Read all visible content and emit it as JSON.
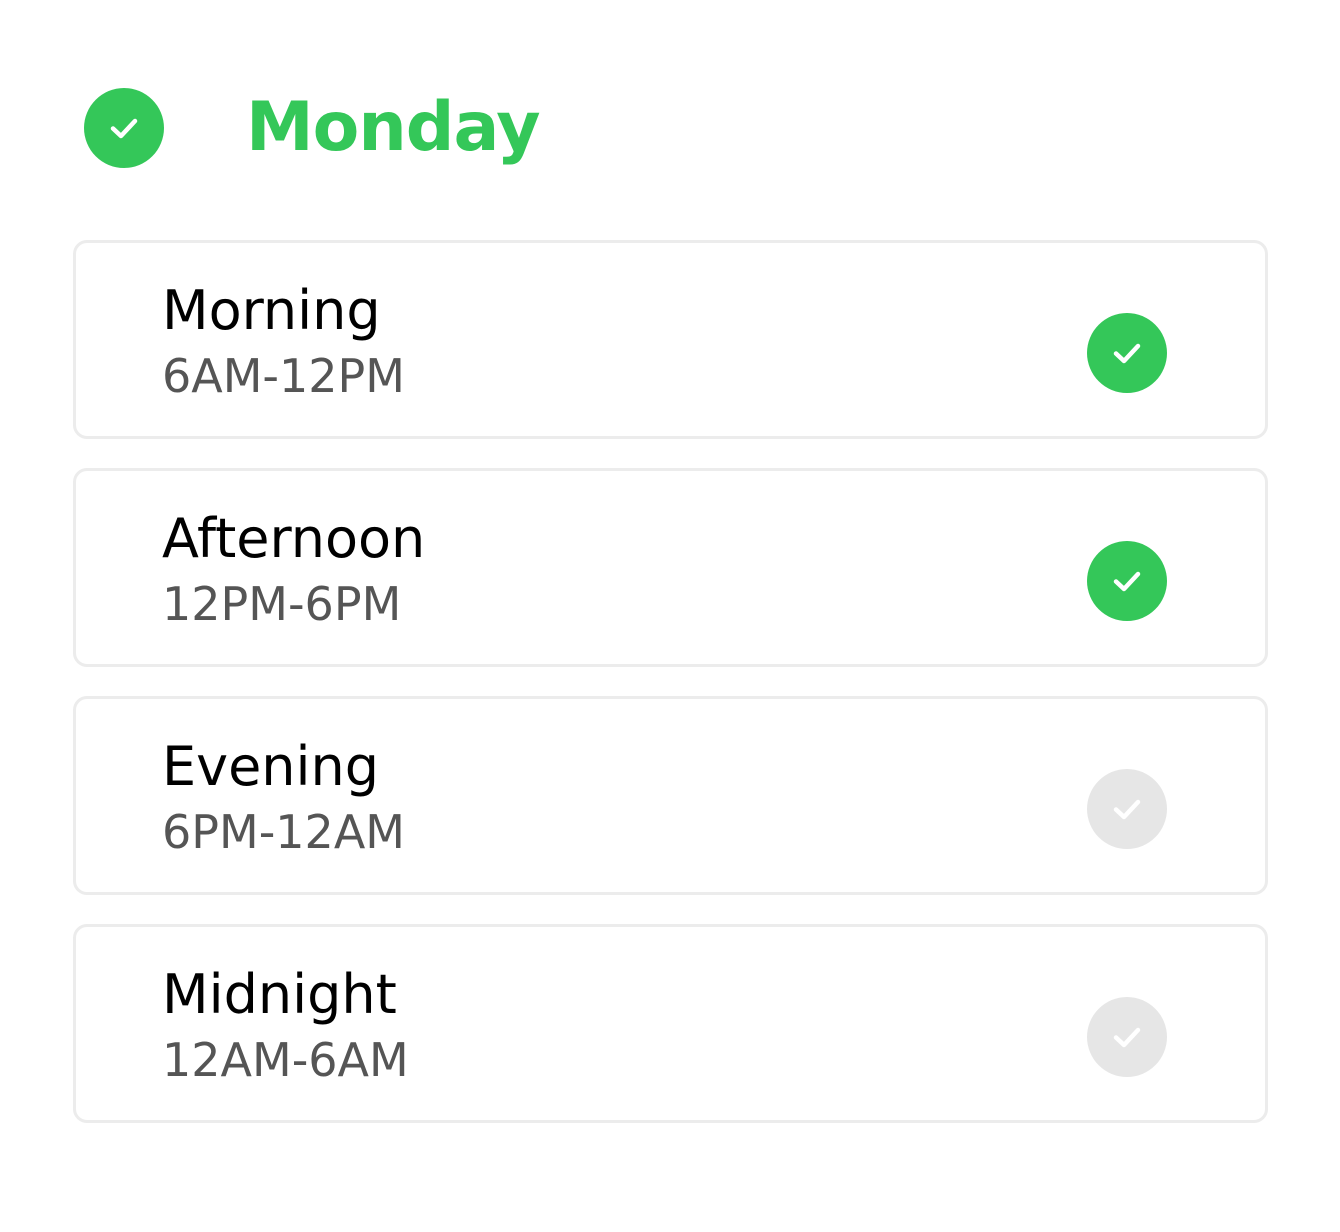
{
  "day": {
    "title": "Monday",
    "selected": true,
    "icon": "check-circle-icon"
  },
  "colors": {
    "accent": "#34c759",
    "inactive": "#e6e6e6",
    "check_mark": "#ffffff"
  },
  "slots": [
    {
      "name": "Morning",
      "range": "6AM-12PM",
      "selected": true,
      "icon": "check-circle-icon"
    },
    {
      "name": "Afternoon",
      "range": "12PM-6PM",
      "selected": true,
      "icon": "check-circle-icon"
    },
    {
      "name": "Evening",
      "range": "6PM-12AM",
      "selected": false,
      "icon": "check-circle-icon"
    },
    {
      "name": "Midnight",
      "range": "12AM-6AM",
      "selected": false,
      "icon": "check-circle-icon"
    }
  ]
}
